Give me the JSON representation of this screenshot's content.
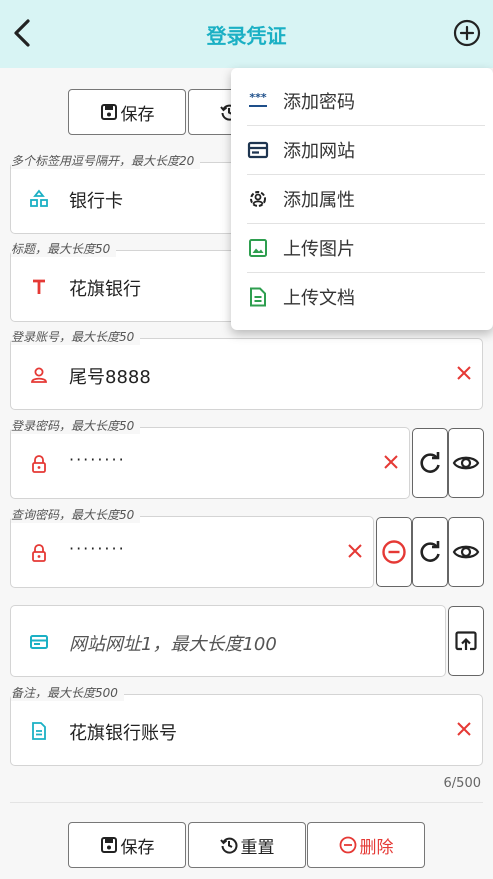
{
  "header": {
    "title": "登录凭证"
  },
  "actions": {
    "save": "保存",
    "reset": "重置",
    "delete": "删除"
  },
  "fields": {
    "tags": {
      "label": "多个标签用逗号隔开，最大长度20",
      "value": "银行卡"
    },
    "title": {
      "label": "标题，最大长度50",
      "value": "花旗银行"
    },
    "account": {
      "label": "登录账号，最大长度50",
      "value": "尾号8888"
    },
    "login_password": {
      "label": "登录密码，最大长度50",
      "value": "········"
    },
    "query_password": {
      "label": "查询密码，最大长度50",
      "value": "········"
    },
    "website": {
      "placeholder": "网站网址1，最大长度100"
    },
    "note": {
      "label": "备注，最大长度500",
      "value": "花旗银行账号",
      "counter": "6/500"
    }
  },
  "menu": {
    "items": [
      {
        "label": "添加密码",
        "icon": "password-icon"
      },
      {
        "label": "添加网站",
        "icon": "website-icon"
      },
      {
        "label": "添加属性",
        "icon": "attribute-icon"
      },
      {
        "label": "上传图片",
        "icon": "image-icon"
      },
      {
        "label": "上传文档",
        "icon": "document-icon"
      }
    ]
  },
  "colors": {
    "accent": "#1bb0c4",
    "danger": "#e53935",
    "success": "#2e9e4f",
    "header_bg": "#d8f4f4"
  }
}
